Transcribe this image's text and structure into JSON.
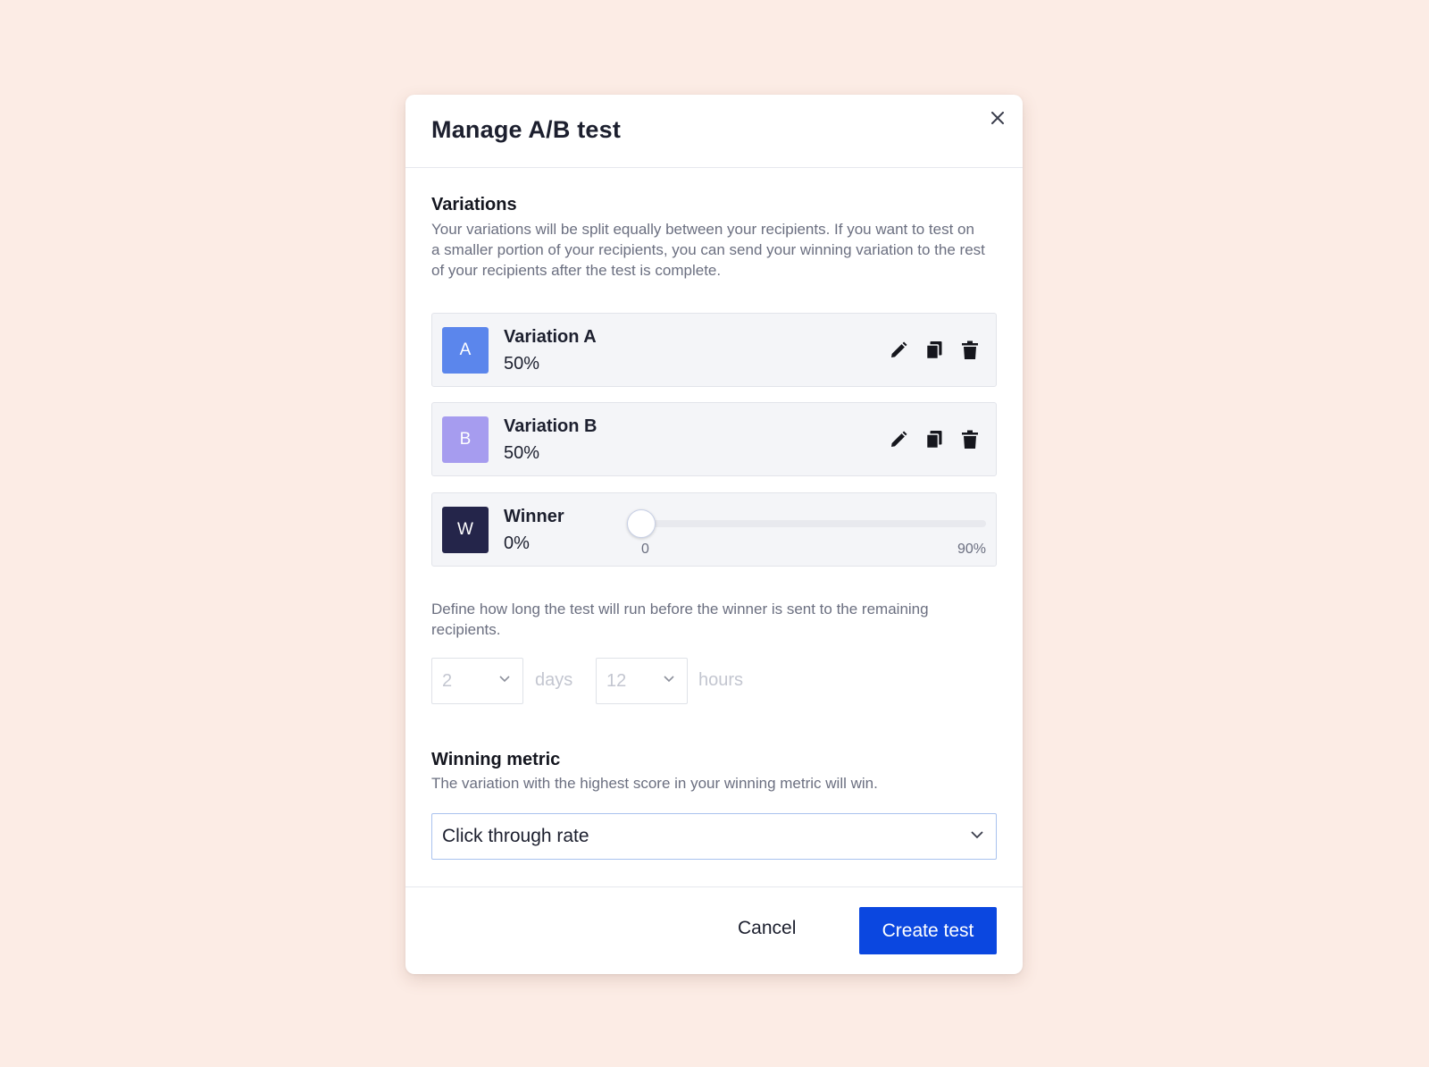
{
  "modal": {
    "title": "Manage A/B test"
  },
  "variations_section": {
    "title": "Variations",
    "description": "Your variations will be split equally between your recipients. If you want to test on a smaller portion of your recipients, you can send your winning variation to the rest of your recipients after the test is complete.",
    "items": [
      {
        "badge": "A",
        "name": "Variation A",
        "percent": "50%",
        "color": "#5b86ec"
      },
      {
        "badge": "B",
        "name": "Variation B",
        "percent": "50%",
        "color": "#a69cef"
      }
    ],
    "winner": {
      "badge": "W",
      "name": "Winner",
      "percent": "0%",
      "color": "#24254a",
      "slider": {
        "value": 0,
        "min_label": "0",
        "max_label": "90%",
        "max": 90
      }
    }
  },
  "duration": {
    "description": "Define how long the test will run before the winner is sent to the remaining recipients.",
    "days_value": "2",
    "days_label": "days",
    "hours_value": "12",
    "hours_label": "hours"
  },
  "winning_metric": {
    "title": "Winning metric",
    "description": "The variation with the highest score in your winning metric will win.",
    "selected": "Click through rate"
  },
  "footer": {
    "cancel_label": "Cancel",
    "create_label": "Create test"
  },
  "colors": {
    "background": "#fcece5",
    "primary": "#0b47e0"
  }
}
